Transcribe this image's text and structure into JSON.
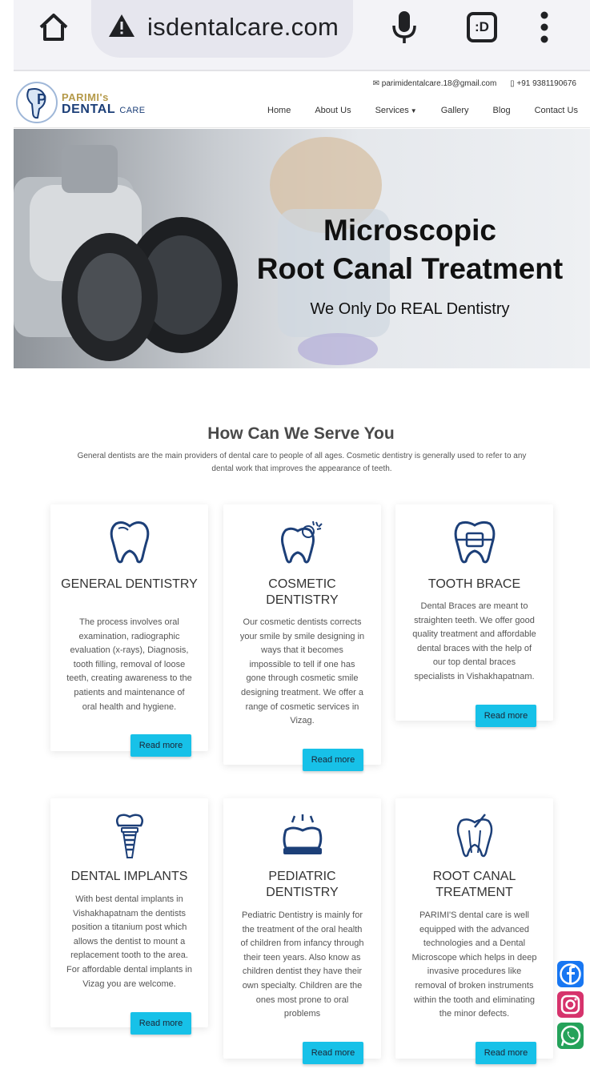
{
  "browser": {
    "url": "isdentalcare.com",
    "tabs_label": ":D",
    "icons": [
      "home-icon",
      "warning-icon",
      "mic-icon",
      "tabs-icon",
      "menu-icon"
    ]
  },
  "header": {
    "logo_line1": "PARIMI's",
    "logo_line2": "DENTAL",
    "logo_line3": "CARE",
    "email": "parimidentalcare.18@gmail.com",
    "phone": "+91 9381190676",
    "nav": [
      "Home",
      "About Us",
      "Services",
      "Gallery",
      "Blog",
      "Contact Us"
    ]
  },
  "hero": {
    "line1": "Microscopic",
    "line2": "Root Canal Treatment",
    "line3": "We Only Do REAL Dentistry"
  },
  "services_section": {
    "title": "How Can We Serve You",
    "subtitle": "General dentists are the main providers of dental care to people of all ages. Cosmetic dentistry is generally used to refer to any dental work that improves the appearance of teeth."
  },
  "cards": [
    {
      "title": "GENERAL DENTISTRY",
      "text": "The process involves oral examination, radiographic evaluation (x-rays), Diagnosis, tooth filling, removal of loose teeth, creating awareness to the patients and maintenance of oral health and hygiene.",
      "button": "Read more",
      "icon": "tooth-icon"
    },
    {
      "title": "COSMETIC DENTISTRY",
      "text": "Our cosmetic dentists corrects your smile by smile designing in ways that it becomes impossible to tell if one has gone through cosmetic smile designing treatment. We offer a range of cosmetic services in Vizag.",
      "button": "Read more",
      "icon": "sparkle-tooth-icon"
    },
    {
      "title": "TOOTH BRACE",
      "text": "Dental Braces are meant to straighten teeth. We offer good quality treatment and affordable dental braces with the help of our top dental braces specialists in Vishakhapatnam.",
      "button": "Read more",
      "icon": "braces-icon"
    },
    {
      "title": "DENTAL IMPLANTS",
      "text": "With best dental implants in Vishakhapatnam the dentists position a titanium post which allows the dentist to mount a replacement tooth to the area. For affordable dental implants in Vizag you are welcome.",
      "button": "Read more",
      "icon": "implant-icon"
    },
    {
      "title": "PEDIATRIC DENTISTRY",
      "text": "Pediatric Dentistry is mainly for the treatment of the oral health of children from infancy through their teen years. Also know as children dentist they have their own specialty. Children are the ones most prone to oral problems",
      "button": "Read more",
      "icon": "crown-tooth-icon"
    },
    {
      "title": "ROOT CANAL TREATMENT",
      "text": "PARIMI'S dental care is well equipped with the advanced technologies and a Dental Microscope which helps in deep invasive procedures like removal of broken instruments within the tooth and eliminating the minor defects.",
      "button": "Read more",
      "icon": "root-canal-icon"
    }
  ],
  "social": [
    "facebook-icon",
    "instagram-icon",
    "whatsapp-icon"
  ],
  "colors": {
    "accent": "#17c1e8",
    "brand_blue": "#1c3f78",
    "brand_gold": "#b59a4a"
  }
}
